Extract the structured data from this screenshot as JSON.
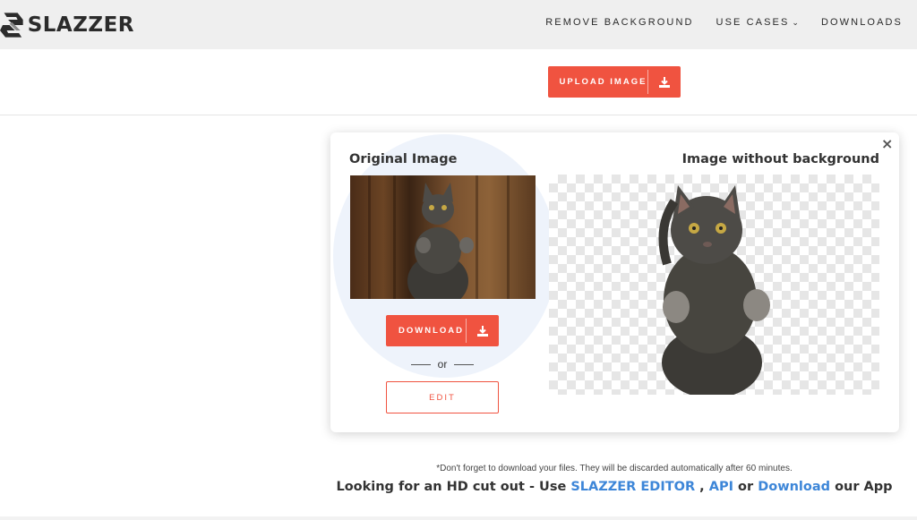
{
  "header": {
    "logo_text": "SLAZZER",
    "nav": [
      {
        "label": "REMOVE BACKGROUND",
        "has_dropdown": false
      },
      {
        "label": "USE CASES",
        "has_dropdown": true
      },
      {
        "label": "DOWNLOADS",
        "has_dropdown": false
      }
    ]
  },
  "upload": {
    "label": "UPLOAD IMAGE",
    "icon": "download-tray-icon"
  },
  "result_card": {
    "close_label": "×",
    "original_heading": "Original Image",
    "processed_heading": "Image without background",
    "download_label": "DOWNLOAD",
    "or_label": "or",
    "edit_label": "EDIT"
  },
  "footer": {
    "note": "*Don't forget to download your files. They will be discarded automatically after 60 minutes.",
    "promo_prefix": "Looking for an HD cut out - Use ",
    "promo_editor": "SLAZZER EDITOR",
    "promo_comma": " , ",
    "promo_api": "API",
    "promo_or": " or ",
    "promo_download": "Download",
    "promo_suffix": " our App"
  },
  "colors": {
    "accent": "#f05340",
    "link": "#3d86d8",
    "header_bg": "#efefef"
  }
}
